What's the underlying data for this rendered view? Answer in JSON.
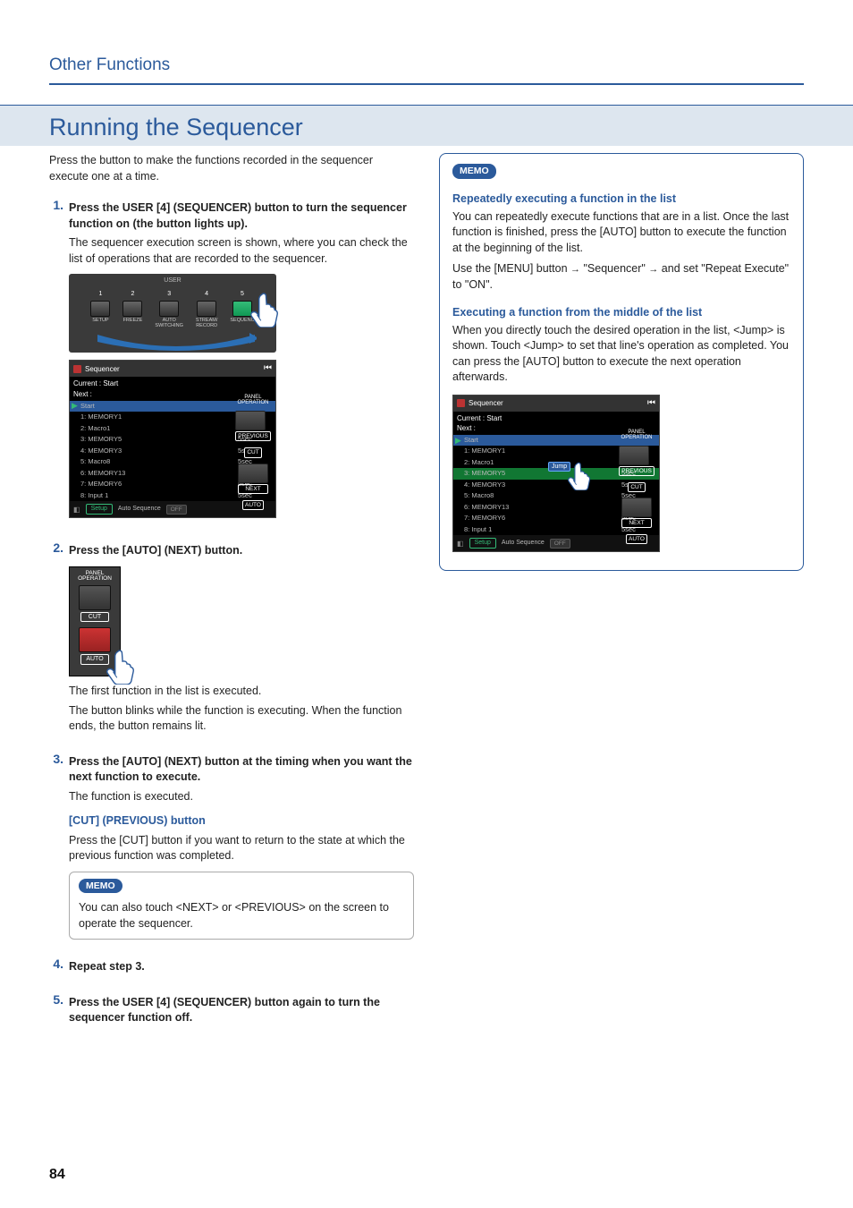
{
  "header": {
    "section_title": "Other Functions"
  },
  "heading": "Running the Sequencer",
  "intro": "Press the button to make the functions recorded in the sequencer execute one at a time.",
  "steps": {
    "s1": {
      "num": "1.",
      "bold": "Press the USER [4] (SEQUENCER) button to turn the sequencer function on (the button lights up).",
      "p1": "The sequencer execution screen is shown, where you can check the list of operations that are recorded to the sequencer."
    },
    "s2": {
      "num": "2.",
      "bold": "Press the [AUTO] (NEXT) button.",
      "p1": "The first function in the list is executed.",
      "p2": "The button blinks while the function is executing. When the function ends, the button remains lit."
    },
    "s3": {
      "num": "3.",
      "bold": "Press the [AUTO] (NEXT) button at the timing when you want the next function to execute.",
      "p1": "The function is executed.",
      "sub_title": "[CUT] (PREVIOUS) button",
      "sub_p": "Press the [CUT] button if you want to return to the state at which the previous function was completed.",
      "memo": "You can also touch <NEXT> or <PREVIOUS> on the screen to operate the sequencer."
    },
    "s4": {
      "num": "4.",
      "bold": "Repeat step 3."
    },
    "s5": {
      "num": "5.",
      "bold": "Press the USER [4] (SEQUENCER) button again to turn the sequencer function off."
    }
  },
  "right_panel": {
    "memo_label": "MEMO",
    "h1": "Repeatedly executing a function in the list",
    "p1": "You can repeatedly execute functions that are in a list. Once the last function is finished, press the [AUTO] button to execute the function at the beginning of the list.",
    "p2a": "Use the [MENU] button ",
    "p2b": " \"Sequencer\" ",
    "p2c": " and set \"Repeat Execute\" to \"ON\".",
    "h2": "Executing a function from the middle of the list",
    "p3": "When you directly touch the desired operation in the list, <Jump> is shown. Touch <Jump> to set that line's operation as completed. You can press the [AUTO] button to execute the next operation afterwards."
  },
  "user_panel": {
    "label": "USER",
    "keys": [
      {
        "num": "1",
        "cap": "SETUP"
      },
      {
        "num": "2",
        "cap": "FREEZE"
      },
      {
        "num": "3",
        "cap": "AUTO\nSWITCHING"
      },
      {
        "num": "4",
        "cap": "STREAM/\nRECORD"
      },
      {
        "num": "5",
        "cap": "SEQUENC"
      }
    ]
  },
  "seq_shot": {
    "title": "Sequencer",
    "current": "Current : Start",
    "next": "Next      :",
    "panel_op": "PANEL\nOPERATION",
    "rows": [
      {
        "c1": "Start",
        "c2": "",
        "hl": true
      },
      {
        "c1": "1: MEMORY1",
        "c2": "5sec",
        "hl": false
      },
      {
        "c1": "2: Macro1",
        "c2": "5sec",
        "hl": false
      },
      {
        "c1": "3: MEMORY5",
        "c2": "5sec",
        "hl": false
      },
      {
        "c1": "4: MEMORY3",
        "c2": "5sec",
        "hl": false
      },
      {
        "c1": "5: Macro8",
        "c2": "5sec",
        "hl": false
      },
      {
        "c1": "6: MEMORY13",
        "c2": "5sec",
        "hl": false
      },
      {
        "c1": "7: MEMORY6",
        "c2": "5sec",
        "hl": false
      },
      {
        "c1": "8: Input 1",
        "c2": "5sec",
        "hl": false
      }
    ],
    "setup_btn": "Setup",
    "auto_seq": "Auto Sequence",
    "toggle": "OFF",
    "btn_prev": "PREVIOUS",
    "btn_cut": "CUT",
    "btn_next": "NEXT",
    "btn_auto": "AUTO",
    "jump_label": "Jump"
  },
  "vpanel": {
    "panel_op": "PANEL\nOPERATION",
    "cut": "CUT",
    "auto": "AUTO"
  },
  "page_number": "84"
}
